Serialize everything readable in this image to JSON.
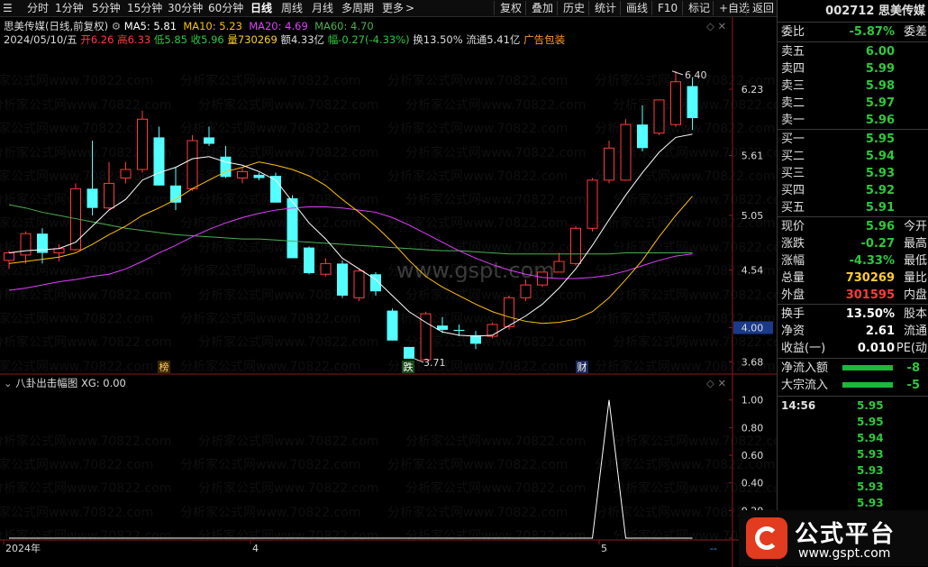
{
  "toolbar": {
    "timeframes": [
      "分时",
      "1分钟",
      "5分钟",
      "15分钟",
      "30分钟",
      "60分钟",
      "日线",
      "周线",
      "月线",
      "多周期",
      "更多"
    ],
    "active": "日线",
    "more_arrow": ">",
    "right_buttons": [
      "复权",
      "叠加",
      "历史",
      "统计",
      "画线",
      "F10",
      "标记",
      "+自选",
      "返回"
    ]
  },
  "header": {
    "title": "思美传媒(日线,前复权)",
    "ma5": "MA5: 5.81",
    "ma10": "MA10: 5.23",
    "ma20": "MA20: 4.69",
    "ma60": "MA60: 4.70",
    "info_date": "2024/05/10/五",
    "open_label": "开",
    "open": "6.26",
    "high_label": "高",
    "high": "6.33",
    "low_label": "低",
    "low": "5.85",
    "close_label": "收",
    "close": "5.96",
    "volume_label": "量",
    "volume": "730269",
    "amount": "额4.33亿",
    "change_label": "幅",
    "change": "-0.27(-4.33%)",
    "turnover": "换13.50%",
    "float": "流通5.41亿",
    "concept": "广告包装"
  },
  "sub_indicator": {
    "title": "八卦出击幅图",
    "xg": "XG: 0.00"
  },
  "panel": {
    "code": "002712",
    "name": "思美传媒",
    "weibi_label": "委比",
    "weibi": "-5.87%",
    "weicha_label": "委差",
    "asks": [
      {
        "label": "卖五",
        "price": "6.00"
      },
      {
        "label": "卖四",
        "price": "5.99"
      },
      {
        "label": "卖三",
        "price": "5.98"
      },
      {
        "label": "卖二",
        "price": "5.97"
      },
      {
        "label": "卖一",
        "price": "5.96"
      }
    ],
    "bids": [
      {
        "label": "买一",
        "price": "5.95"
      },
      {
        "label": "买二",
        "price": "5.94"
      },
      {
        "label": "买三",
        "price": "5.93"
      },
      {
        "label": "买四",
        "price": "5.92"
      },
      {
        "label": "买五",
        "price": "5.91"
      }
    ],
    "stats": [
      {
        "label": "现价",
        "value": "5.96",
        "ext": "今开",
        "color": "dn"
      },
      {
        "label": "涨跌",
        "value": "-0.27",
        "ext": "最高",
        "color": "dn"
      },
      {
        "label": "涨幅",
        "value": "-4.33%",
        "ext": "最低",
        "color": "dn"
      },
      {
        "label": "总量",
        "value": "730269",
        "ext": "量比",
        "color": "yl"
      },
      {
        "label": "外盘",
        "value": "301595",
        "ext": "内盘",
        "color": "up"
      }
    ],
    "stats2": [
      {
        "label": "换手",
        "value": "13.50%",
        "ext": "股本",
        "color": "wh"
      },
      {
        "label": "净资",
        "value": "2.61",
        "ext": "流通",
        "color": "wh"
      },
      {
        "label": "收益(一)",
        "value": "0.010",
        "ext": "PE(动",
        "color": "wh"
      }
    ],
    "flows": [
      {
        "label": "净流入额",
        "value": "-8"
      },
      {
        "label": "大宗流入",
        "value": "-5"
      }
    ],
    "ticks_time": "14:56",
    "ticks": [
      "5.95",
      "5.95",
      "5.94",
      "5.93",
      "5.93",
      "5.93",
      "5.93"
    ]
  },
  "axis": {
    "price_ticks": [
      "6.23",
      "5.61",
      "5.05",
      "4.54",
      "4.00",
      "3.68"
    ],
    "sub_ticks": [
      "1.00",
      "0.80",
      "0.60",
      "0.40",
      "0.20",
      "0.00"
    ],
    "x_labels": [
      "2024年",
      "4",
      "5"
    ],
    "high_label": "6.40",
    "low_label": "3.71",
    "markers": [
      "榜",
      "跌",
      "财"
    ],
    "corner": "--"
  },
  "watermark_text": "分析家公式网www.70822.com",
  "center_watermark": "www.gspt.com",
  "logo": {
    "title": "公式平台",
    "url": "www.gspt.com"
  },
  "colors": {
    "up": "#ff3b3b",
    "down": "#54ffff",
    "ma5": "#ffffff",
    "ma10": "#ffc107",
    "ma20": "#e040fb",
    "ma60": "#4caf50"
  },
  "chart_data": {
    "type": "candlestick",
    "candles": [
      {
        "o": 4.63,
        "h": 4.72,
        "l": 4.55,
        "c": 4.7
      },
      {
        "o": 4.68,
        "h": 4.9,
        "l": 4.6,
        "c": 4.88
      },
      {
        "o": 4.88,
        "h": 4.93,
        "l": 4.6,
        "c": 4.7
      },
      {
        "o": 4.7,
        "h": 4.78,
        "l": 4.62,
        "c": 4.74
      },
      {
        "o": 4.73,
        "h": 5.35,
        "l": 4.72,
        "c": 5.3
      },
      {
        "o": 5.3,
        "h": 5.75,
        "l": 5.05,
        "c": 5.12
      },
      {
        "o": 5.12,
        "h": 5.55,
        "l": 5.1,
        "c": 5.35
      },
      {
        "o": 5.4,
        "h": 5.55,
        "l": 5.35,
        "c": 5.48
      },
      {
        "o": 5.48,
        "h": 6.03,
        "l": 5.45,
        "c": 5.95
      },
      {
        "o": 5.78,
        "h": 5.88,
        "l": 5.33,
        "c": 5.33
      },
      {
        "o": 5.33,
        "h": 5.5,
        "l": 5.1,
        "c": 5.17
      },
      {
        "o": 5.3,
        "h": 5.8,
        "l": 5.28,
        "c": 5.75
      },
      {
        "o": 5.78,
        "h": 5.88,
        "l": 5.7,
        "c": 5.72
      },
      {
        "o": 5.6,
        "h": 5.7,
        "l": 5.4,
        "c": 5.41
      },
      {
        "o": 5.4,
        "h": 5.5,
        "l": 5.35,
        "c": 5.46
      },
      {
        "o": 5.43,
        "h": 5.45,
        "l": 5.38,
        "c": 5.4
      },
      {
        "o": 5.42,
        "h": 5.45,
        "l": 5.17,
        "c": 5.17
      },
      {
        "o": 5.21,
        "h": 5.24,
        "l": 4.65,
        "c": 4.65
      },
      {
        "o": 4.75,
        "h": 4.76,
        "l": 4.5,
        "c": 4.51
      },
      {
        "o": 4.5,
        "h": 4.65,
        "l": 4.48,
        "c": 4.6
      },
      {
        "o": 4.6,
        "h": 4.63,
        "l": 4.28,
        "c": 4.3
      },
      {
        "o": 4.28,
        "h": 4.55,
        "l": 4.25,
        "c": 4.53
      },
      {
        "o": 4.5,
        "h": 4.52,
        "l": 4.3,
        "c": 4.34
      },
      {
        "o": 4.16,
        "h": 4.18,
        "l": 3.88,
        "c": 3.88
      },
      {
        "o": 3.82,
        "h": 3.82,
        "l": 3.71,
        "c": 3.71
      },
      {
        "o": 3.7,
        "h": 4.15,
        "l": 3.7,
        "c": 4.13
      },
      {
        "o": 4.02,
        "h": 4.1,
        "l": 3.95,
        "c": 3.98
      },
      {
        "o": 3.98,
        "h": 4.03,
        "l": 3.92,
        "c": 3.97
      },
      {
        "o": 3.93,
        "h": 3.97,
        "l": 3.8,
        "c": 3.85
      },
      {
        "o": 3.92,
        "h": 4.05,
        "l": 3.9,
        "c": 4.03
      },
      {
        "o": 4.01,
        "h": 4.3,
        "l": 3.98,
        "c": 4.28
      },
      {
        "o": 4.28,
        "h": 4.45,
        "l": 4.25,
        "c": 4.4
      },
      {
        "o": 4.4,
        "h": 4.52,
        "l": 4.38,
        "c": 4.52
      },
      {
        "o": 4.52,
        "h": 4.7,
        "l": 4.52,
        "c": 4.62
      },
      {
        "o": 4.6,
        "h": 4.95,
        "l": 4.58,
        "c": 4.93
      },
      {
        "o": 4.93,
        "h": 5.4,
        "l": 4.9,
        "c": 5.38
      },
      {
        "o": 5.38,
        "h": 5.75,
        "l": 5.35,
        "c": 5.68
      },
      {
        "o": 5.38,
        "h": 5.95,
        "l": 5.38,
        "c": 5.9
      },
      {
        "o": 5.9,
        "h": 6.08,
        "l": 5.65,
        "c": 5.68
      },
      {
        "o": 5.82,
        "h": 6.1,
        "l": 5.8,
        "c": 6.13
      },
      {
        "o": 5.9,
        "h": 6.4,
        "l": 5.88,
        "c": 6.3
      },
      {
        "o": 6.26,
        "h": 6.33,
        "l": 5.85,
        "c": 5.96
      }
    ],
    "ma5": [
      4.7,
      4.72,
      4.73,
      4.74,
      4.8,
      4.95,
      5.1,
      5.2,
      5.38,
      5.45,
      5.5,
      5.58,
      5.6,
      5.55,
      5.52,
      5.46,
      5.38,
      5.18,
      4.98,
      4.83,
      4.65,
      4.55,
      4.45,
      4.3,
      4.15,
      4.05,
      3.96,
      3.93,
      3.92,
      3.93,
      4.02,
      4.11,
      4.22,
      4.37,
      4.55,
      4.77,
      5.01,
      5.24,
      5.45,
      5.64,
      5.78,
      5.81
    ],
    "ma10": [
      4.6,
      4.62,
      4.64,
      4.66,
      4.7,
      4.78,
      4.87,
      4.95,
      5.05,
      5.12,
      5.2,
      5.3,
      5.38,
      5.46,
      5.5,
      5.55,
      5.52,
      5.48,
      5.42,
      5.33,
      5.2,
      5.08,
      4.95,
      4.8,
      4.63,
      4.48,
      4.38,
      4.3,
      4.22,
      4.15,
      4.1,
      4.06,
      4.04,
      4.05,
      4.08,
      4.15,
      4.28,
      4.45,
      4.63,
      4.85,
      5.05,
      5.23
    ],
    "ma20": [
      4.35,
      4.37,
      4.4,
      4.43,
      4.45,
      4.48,
      4.5,
      4.55,
      4.62,
      4.7,
      4.77,
      4.85,
      4.92,
      4.98,
      5.03,
      5.07,
      5.1,
      5.12,
      5.13,
      5.13,
      5.12,
      5.1,
      5.08,
      5.03,
      4.96,
      4.88,
      4.8,
      4.72,
      4.65,
      4.59,
      4.54,
      4.5,
      4.47,
      4.46,
      4.46,
      4.47,
      4.49,
      4.53,
      4.58,
      4.63,
      4.67,
      4.69
    ],
    "ma60": [
      5.15,
      5.12,
      5.08,
      5.05,
      5.02,
      4.99,
      4.96,
      4.93,
      4.91,
      4.89,
      4.87,
      4.86,
      4.85,
      4.84,
      4.83,
      4.83,
      4.82,
      4.81,
      4.8,
      4.79,
      4.78,
      4.77,
      4.76,
      4.75,
      4.74,
      4.73,
      4.72,
      4.72,
      4.71,
      4.7,
      4.69,
      4.69,
      4.69,
      4.69,
      4.69,
      4.69,
      4.69,
      4.7,
      4.7,
      4.7,
      4.7,
      4.7
    ],
    "xg": [
      0,
      0,
      0,
      0,
      0,
      0,
      0,
      0,
      0,
      0,
      0,
      0,
      0,
      0,
      0,
      0,
      0,
      0,
      0,
      0,
      0,
      0,
      0,
      0,
      0,
      0,
      0,
      0,
      0,
      0,
      0,
      0,
      0,
      0,
      0,
      0,
      1,
      0,
      0,
      0,
      0,
      0
    ],
    "price_range": [
      3.6,
      6.5
    ],
    "sub_range": [
      0,
      1.05
    ]
  }
}
